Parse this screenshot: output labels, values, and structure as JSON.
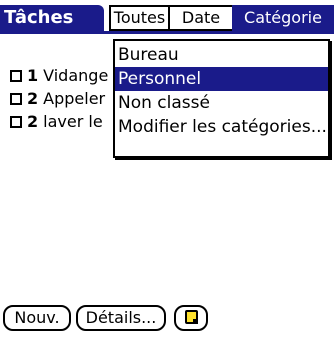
{
  "app": {
    "title": "Tâches"
  },
  "filters": {
    "all": "Toutes",
    "date": "Date",
    "category": "Catégorie",
    "active": "category"
  },
  "tasks": [
    {
      "priority": "1",
      "text": "Vidange"
    },
    {
      "priority": "2",
      "text": "Appeler"
    },
    {
      "priority": "2",
      "text": "laver le"
    }
  ],
  "category_menu": {
    "items": [
      {
        "label": "Bureau",
        "selected": false
      },
      {
        "label": "Personnel",
        "selected": true
      },
      {
        "label": "Non classé",
        "selected": false
      },
      {
        "label": "Modifier les catégories...",
        "selected": false
      }
    ]
  },
  "buttons": {
    "new": "Nouv.",
    "details": "Détails...",
    "note_icon": "note-icon"
  },
  "colors": {
    "accent": "#1a1b8a",
    "note": "#ffe22e"
  }
}
